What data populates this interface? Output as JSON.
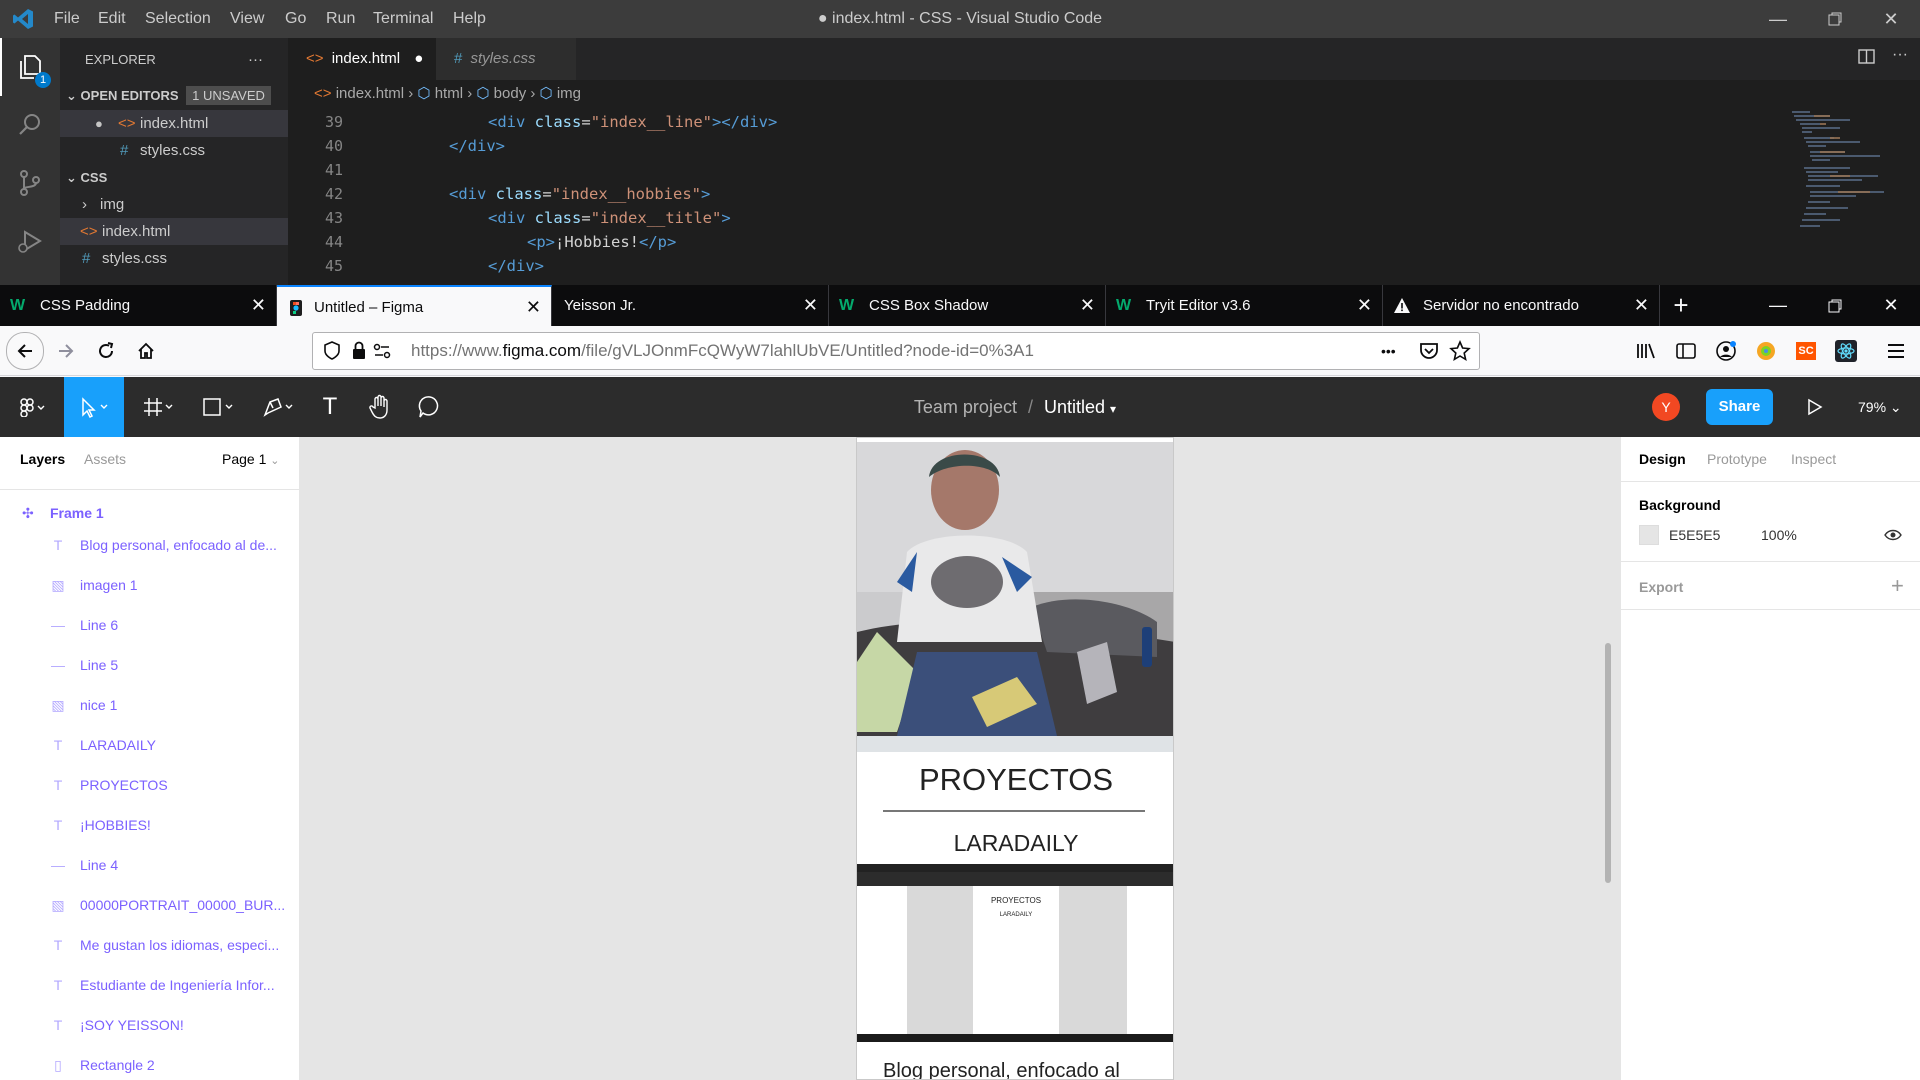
{
  "vscode": {
    "menu": [
      "File",
      "Edit",
      "Selection",
      "View",
      "Go",
      "Run",
      "Terminal",
      "Help"
    ],
    "title": "● index.html - CSS - Visual Studio Code",
    "explorer_label": "EXPLORER",
    "explorer_more": "···",
    "open_editors_label": "OPEN EDITORS",
    "unsaved_badge": "1 UNSAVED",
    "open_editors": [
      "index.html",
      "styles.css"
    ],
    "folder_label": "CSS",
    "folder_items": [
      "img",
      "index.html",
      "styles.css"
    ],
    "activity_badge": "1",
    "tabs": [
      {
        "label": "index.html",
        "dirty": "●"
      },
      {
        "label": "styles.css"
      }
    ],
    "breadcrumbs": [
      "index.html",
      "html",
      "body",
      "img"
    ],
    "line_numbers": [
      "39",
      "40",
      "41",
      "42",
      "43",
      "44",
      "45"
    ],
    "code": {
      "l39": {
        "a": "<div ",
        "b": "class",
        "c": "=",
        "d": "\"index__line\"",
        "e": "></div>"
      },
      "l40": {
        "a": "</div>"
      },
      "l42": {
        "a": "<div ",
        "b": "class",
        "c": "=",
        "d": "\"index__hobbies\"",
        "e": ">"
      },
      "l43": {
        "a": "<div ",
        "b": "class",
        "c": "=",
        "d": "\"index__title\"",
        "e": ">"
      },
      "l44": {
        "a": "<p>",
        "b": "¡Hobbies!",
        "c": "</p>"
      },
      "l45": {
        "a": "</div>"
      }
    }
  },
  "firefox": {
    "tabs": [
      {
        "label": "CSS Padding"
      },
      {
        "label": "Untitled – Figma"
      },
      {
        "label": "Yeisson Jr."
      },
      {
        "label": "CSS Box Shadow"
      },
      {
        "label": "Tryit Editor v3.6"
      },
      {
        "label": "Servidor no encontrado"
      }
    ],
    "new_tab": "+",
    "url_prefix": "https://www.",
    "url_domain": "figma.com",
    "url_rest": "/file/gVLJOnmFcQWyW7lahlUbVE/Untitled?node-id=0%3A1",
    "url_more": "•••"
  },
  "figma": {
    "breadcrumb_team": "Team project",
    "breadcrumb_sep": "/",
    "file_name": "Untitled",
    "avatar_letter": "Y",
    "share_label": "Share",
    "zoom": "79%",
    "panel_tabs": [
      "Layers",
      "Assets"
    ],
    "page_select": "Page 1",
    "frame_label": "Frame 1",
    "layers": [
      {
        "name": "Blog personal, enfocado al de...",
        "icon": "T"
      },
      {
        "name": "imagen 1",
        "icon": "img"
      },
      {
        "name": "Line 6",
        "icon": "—"
      },
      {
        "name": "Line 5",
        "icon": "—"
      },
      {
        "name": "nice 1",
        "icon": "img"
      },
      {
        "name": "LARADAILY",
        "icon": "T"
      },
      {
        "name": "PROYECTOS",
        "icon": "T"
      },
      {
        "name": "¡HOBBIES!",
        "icon": "T"
      },
      {
        "name": "Line 4",
        "icon": "—"
      },
      {
        "name": "00000PORTRAIT_00000_BUR...",
        "icon": "img"
      },
      {
        "name": "Me gustan los idiomas, especi...",
        "icon": "T"
      },
      {
        "name": "Estudiante de Ingeniería Infor...",
        "icon": "T"
      },
      {
        "name": "¡SOY YEISSON!",
        "icon": "T"
      },
      {
        "name": "Rectangle 2",
        "icon": "▯"
      }
    ],
    "design_tabs": [
      "Design",
      "Prototype",
      "Inspect"
    ],
    "background_label": "Background",
    "bg_hex": "E5E5E5",
    "bg_opacity": "100%",
    "export_label": "Export",
    "export_add": "+",
    "canvas": {
      "heading1": "PROYECTOS",
      "heading2": "LARADAILY",
      "mini_heading1": "PROYECTOS",
      "mini_heading2": "LARADAILY",
      "bottom_text": "Blog personal, enfocado al"
    }
  }
}
